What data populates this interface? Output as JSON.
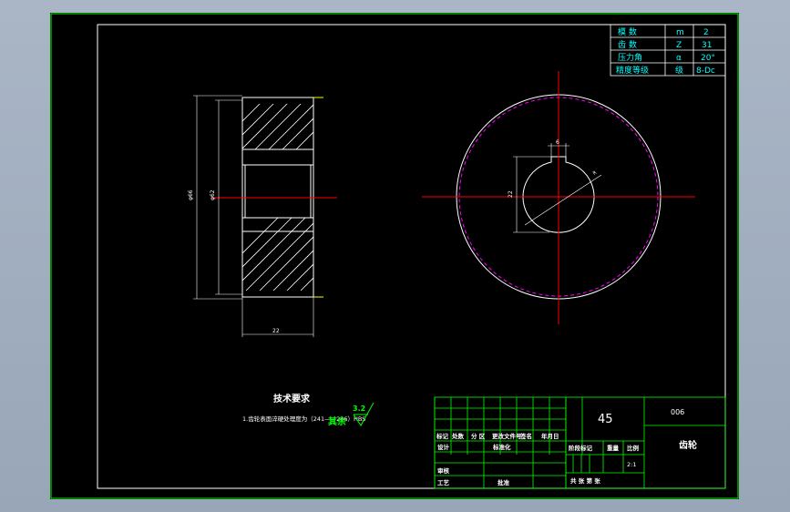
{
  "params_table": {
    "rows": [
      {
        "name": "模  数",
        "symbol": "m",
        "value": "2"
      },
      {
        "name": "齿  数",
        "symbol": "Z",
        "value": "31"
      },
      {
        "name": "压力角",
        "symbol": "α",
        "value": "20°"
      },
      {
        "name": "精度等级",
        "symbol": "级",
        "value": "8-Dc"
      }
    ]
  },
  "section_view": {
    "dim_outer": "φ66",
    "dim_pitch": "φ62",
    "dim_width": "22"
  },
  "front_view": {
    "dim_bore": "22",
    "dim_key": "6",
    "dim_r": "R"
  },
  "tech_requirements": {
    "title": "技术要求",
    "item1": "1.齿轮表面淬硬处理度为（241——286）HBS",
    "roughness_value": "3.2",
    "roughness_label": "其余"
  },
  "title_block": {
    "material": "45",
    "drawing_no": "006",
    "part_name": "齿轮",
    "scale": "2:1",
    "headers": [
      "标记",
      "处数",
      "分 区",
      "更改文件号",
      "签名",
      "年月日"
    ],
    "design": "设计",
    "standardize": "标准化",
    "review": "审核",
    "process": "工艺",
    "approve": "批准",
    "stage_mark": "阶段标记",
    "weight": "重量",
    "ratio": "比例",
    "sheets": "共  张  第  张"
  },
  "colors": {
    "background": "#000000",
    "frame": "#ffffff",
    "title_block": "#00ff00",
    "centerline": "#ff0000",
    "dimension": "#ffffff",
    "addendum_circle": "#ff00ff",
    "hatch": "#ffffff",
    "roughness": "#00ff00"
  }
}
